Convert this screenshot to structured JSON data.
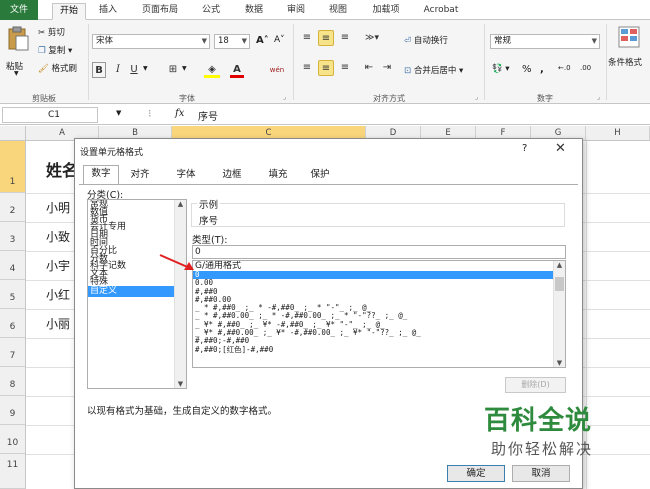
{
  "ribbon_tabs": [
    "文件",
    "开始",
    "插入",
    "页面布局",
    "公式",
    "数据",
    "审阅",
    "视图",
    "加载项",
    "Acrobat"
  ],
  "clipboard": {
    "paste": "粘贴",
    "cut": "剪切",
    "copy": "复制",
    "format_painter": "格式刷",
    "group": "剪贴板"
  },
  "font": {
    "name": "宋体",
    "size": "18",
    "group": "字体",
    "bold": "B",
    "italic": "I",
    "underline": "U",
    "grow": "A",
    "shrink": "A",
    "font_color": "A",
    "phonetic": "wén"
  },
  "alignment": {
    "wrap": "自动换行",
    "merge": "合并后居中",
    "group": "对齐方式"
  },
  "number": {
    "format": "常规",
    "group": "数字",
    "percent": "%",
    "comma": ","
  },
  "styles": {
    "conditional": "条件格式"
  },
  "formula_bar": {
    "name_box": "C1",
    "fx": "fx",
    "content": "序号"
  },
  "grid": {
    "columns": [
      "A",
      "B",
      "C",
      "D",
      "E",
      "F",
      "G",
      "H"
    ],
    "rows": [
      "1",
      "2",
      "3",
      "4",
      "5",
      "6",
      "7",
      "8",
      "9",
      "10",
      "11"
    ],
    "cells": [
      "姓名",
      "小明",
      "小致",
      "小宇",
      "小红",
      "小丽"
    ]
  },
  "dialog": {
    "title": "设置单元格格式",
    "help": "?",
    "tabs": [
      "数字",
      "对齐",
      "字体",
      "边框",
      "填充",
      "保护"
    ],
    "category_label": "分类(C):",
    "categories": [
      "常规",
      "数值",
      "货币",
      "会计专用",
      "日期",
      "时间",
      "百分比",
      "分数",
      "科学记数",
      "文本",
      "特殊",
      "自定义"
    ],
    "selected_category": "自定义",
    "sample_label": "示例",
    "sample_value": "序号",
    "type_label": "类型(T):",
    "type_value": "0",
    "formats": [
      "G/通用格式",
      "0",
      "0.00",
      "#,##0",
      "#,##0.00",
      "_ * #,##0_ ;_ * -#,##0_ ;_ * \"-\"_ ;_ @_",
      "_ * #,##0.00_ ;_ * -#,##0.00_ ;_ * \"-\"??_ ;_ @_",
      "_ ¥* #,##0_ ;_ ¥* -#,##0_ ;_ ¥* \"-\"_ ;_ @_",
      "_ ¥* #,##0.00_ ;_ ¥* -#,##0.00_ ;_ ¥* \"-\"??_ ;_ @_",
      "#,##0;-#,##0",
      "#,##0;[红色]-#,##0"
    ],
    "selected_format": "0",
    "delete_button": "删除(D)",
    "description": "以现有格式为基础，生成自定义的数字格式。",
    "ok": "确定",
    "cancel": "取消"
  },
  "watermark": {
    "main": "百科全说",
    "sub": "助你轻松解决"
  },
  "colors": {
    "file_tab": "#2a7a3b",
    "selection": "#3399ff",
    "arrow": "#e02020",
    "watermark": "#2e8b3e"
  }
}
